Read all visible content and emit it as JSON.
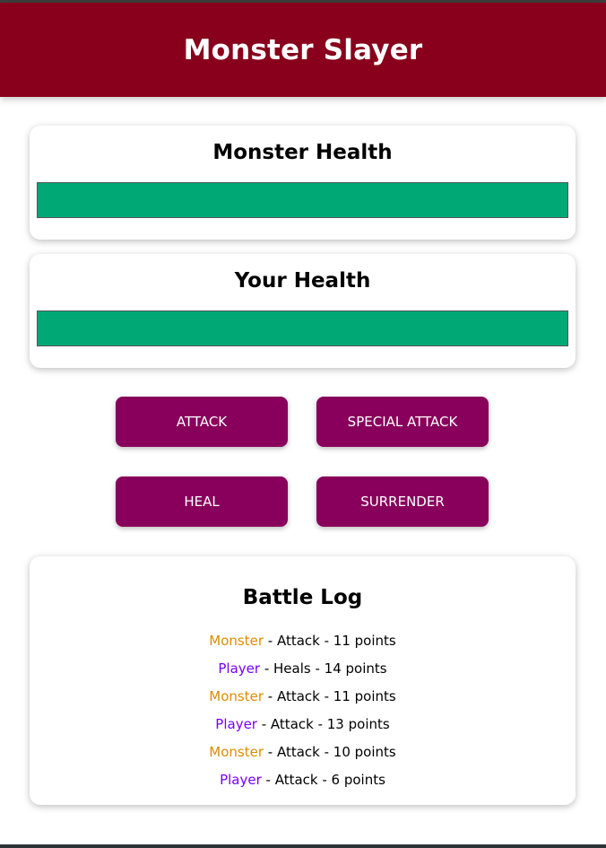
{
  "app": {
    "title": "Monster Slayer"
  },
  "monster_health": {
    "heading": "Monster Health",
    "value_percent": 100
  },
  "player_health": {
    "heading": "Your Health",
    "value_percent": 100
  },
  "controls": {
    "attack_label": "ATTACK",
    "special_attack_label": "SPECIAL ATTACK",
    "heal_label": "HEAL",
    "surrender_label": "SURRENDER"
  },
  "battle_log": {
    "heading": "Battle Log",
    "entries": [
      {
        "who": "Monster",
        "rest": " - Attack - 11 points"
      },
      {
        "who": "Player",
        "rest": " - Heals - 14 points"
      },
      {
        "who": "Monster",
        "rest": " - Attack - 11 points"
      },
      {
        "who": "Player",
        "rest": " - Attack - 13 points"
      },
      {
        "who": "Monster",
        "rest": " - Attack - 10 points"
      },
      {
        "who": "Player",
        "rest": " - Attack - 6 points"
      }
    ]
  },
  "colors": {
    "header": "#88001b",
    "button": "#88005b",
    "health_bar": "#00a876",
    "monster_name": "#da8d00",
    "player_name": "#7700ff"
  }
}
